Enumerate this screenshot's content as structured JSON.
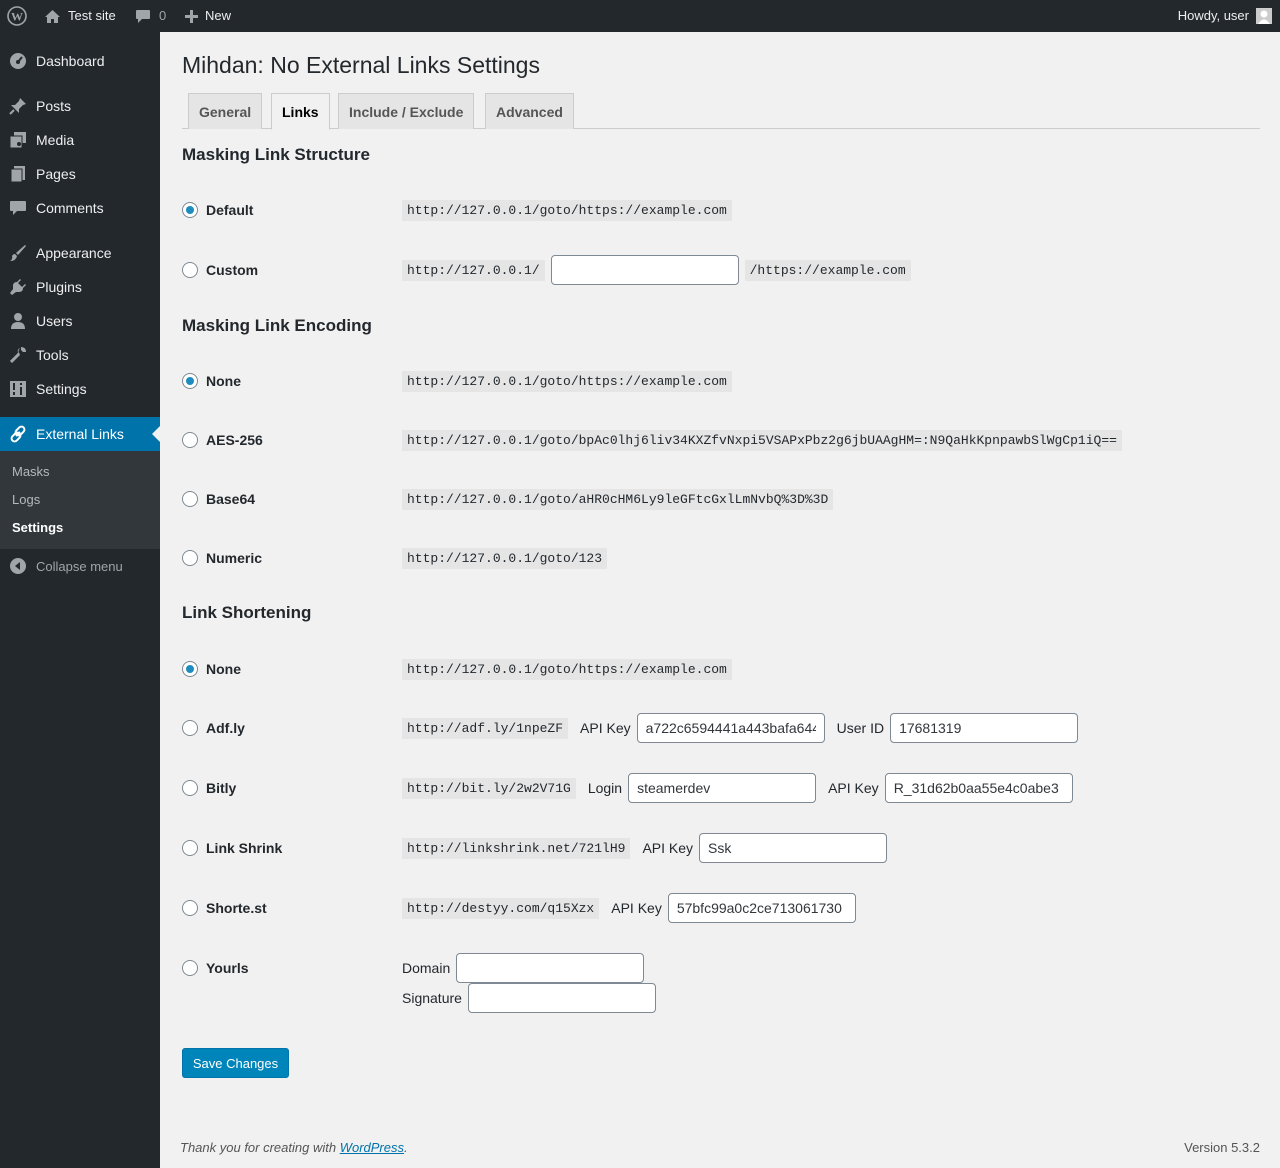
{
  "adminbar": {
    "site_name": "Test site",
    "comments_count": "0",
    "new_label": "New",
    "howdy": "Howdy, user"
  },
  "sidebar": {
    "items": [
      {
        "label": "Dashboard",
        "icon": "dashboard-icon"
      },
      {
        "label": "Posts",
        "icon": "pin-icon"
      },
      {
        "label": "Media",
        "icon": "media-icon"
      },
      {
        "label": "Pages",
        "icon": "pages-icon"
      },
      {
        "label": "Comments",
        "icon": "comment-icon"
      },
      {
        "label": "Appearance",
        "icon": "brush-icon"
      },
      {
        "label": "Plugins",
        "icon": "plugin-icon"
      },
      {
        "label": "Users",
        "icon": "user-icon"
      },
      {
        "label": "Tools",
        "icon": "wrench-icon"
      },
      {
        "label": "Settings",
        "icon": "settings-icon"
      },
      {
        "label": "External Links",
        "icon": "link-icon"
      }
    ],
    "submenu": [
      "Masks",
      "Logs",
      "Settings"
    ],
    "collapse": "Collapse menu"
  },
  "page": {
    "title": "Mihdan: No External Links Settings",
    "tabs": [
      "General",
      "Links",
      "Include / Exclude",
      "Advanced"
    ],
    "active_tab": "Links"
  },
  "structure": {
    "heading": "Masking Link Structure",
    "default_label": "Default",
    "default_example": "http://127.0.0.1/goto/https://example.com",
    "custom_label": "Custom",
    "custom_prefix": "http://127.0.0.1/",
    "custom_value": "",
    "custom_suffix": "/https://example.com"
  },
  "encoding": {
    "heading": "Masking Link Encoding",
    "options": [
      {
        "label": "None",
        "example": "http://127.0.0.1/goto/https://example.com"
      },
      {
        "label": "AES-256",
        "example": "http://127.0.0.1/goto/bpAc0lhj6liv34KXZfvNxpi5VSAPxPbz2g6jbUAAgHM=:N9QaHkKpnpawbSlWgCp1iQ=="
      },
      {
        "label": "Base64",
        "example": "http://127.0.0.1/goto/aHR0cHM6Ly9leGFtcGxlLmNvbQ%3D%3D"
      },
      {
        "label": "Numeric",
        "example": "http://127.0.0.1/goto/123"
      }
    ]
  },
  "shortening": {
    "heading": "Link Shortening",
    "none": {
      "label": "None",
      "example": "http://127.0.0.1/goto/https://example.com"
    },
    "adfly": {
      "label": "Adf.ly",
      "example": "http://adf.ly/1npeZF",
      "api_key_label": "API Key",
      "api_key": "a722c6594441a443bafa644",
      "user_id_label": "User ID",
      "user_id": "17681319"
    },
    "bitly": {
      "label": "Bitly",
      "example": "http://bit.ly/2w2V71G",
      "login_label": "Login",
      "login": "steamerdev",
      "api_key_label": "API Key",
      "api_key": "R_31d62b0aa55e4c0abe3"
    },
    "linkshrink": {
      "label": "Link Shrink",
      "example": "http://linkshrink.net/721lH9",
      "api_key_label": "API Key",
      "api_key": "Ssk"
    },
    "shortest": {
      "label": "Shorte.st",
      "example": "http://destyy.com/q15Xzx",
      "api_key_label": "API Key",
      "api_key": "57bfc99a0c2ce713061730"
    },
    "yourls": {
      "label": "Yourls",
      "domain_label": "Domain",
      "domain": "",
      "signature_label": "Signature",
      "signature": ""
    }
  },
  "save_label": "Save Changes",
  "footer": {
    "thanks_prefix": "Thank you for creating with ",
    "wordpress_link": "WordPress",
    "thanks_suffix": ".",
    "version": "Version 5.3.2"
  }
}
